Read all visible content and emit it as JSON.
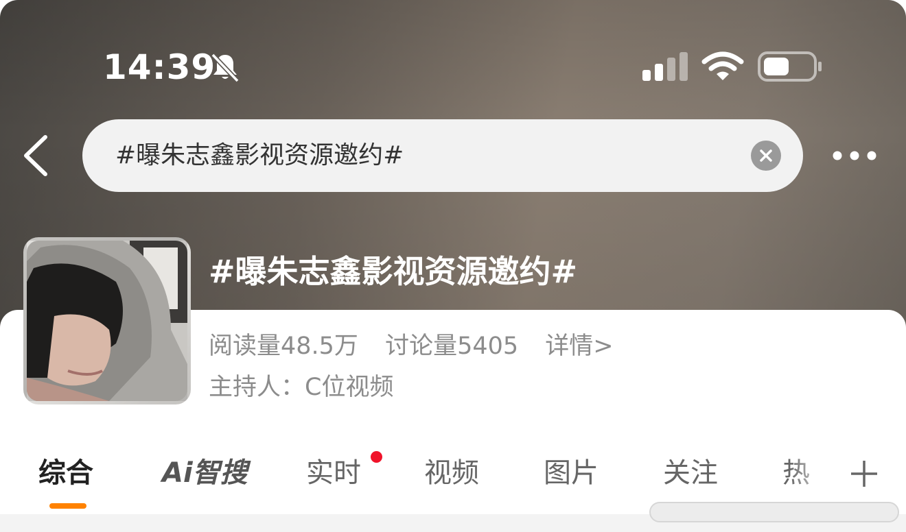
{
  "status_bar": {
    "time": "14:39",
    "icons": [
      "bell-slash-icon",
      "cellular-signal-icon",
      "wifi-icon",
      "battery-icon"
    ]
  },
  "search": {
    "query": "#曝朱志鑫影视资源邀约#",
    "icons": [
      "back-chevron-icon",
      "clear-icon",
      "more-icon"
    ]
  },
  "topic": {
    "title": "#曝朱志鑫影视资源邀约#",
    "reads": "阅读量48.5万",
    "discussions": "讨论量5405",
    "details_link": "详情>",
    "host": "主持人：C位视频"
  },
  "tabs": [
    {
      "label": "综合",
      "active": true
    },
    {
      "label": "Ai智搜",
      "active": false
    },
    {
      "label": "实时",
      "active": false,
      "badge": "red-dot"
    },
    {
      "label": "视频",
      "active": false
    },
    {
      "label": "图片",
      "active": false
    },
    {
      "label": "关注",
      "active": false
    },
    {
      "label": "热",
      "active": false
    }
  ],
  "colors": {
    "accent": "#ff8200",
    "badge": "#f0132a",
    "muted_text": "#8c8c8c"
  }
}
